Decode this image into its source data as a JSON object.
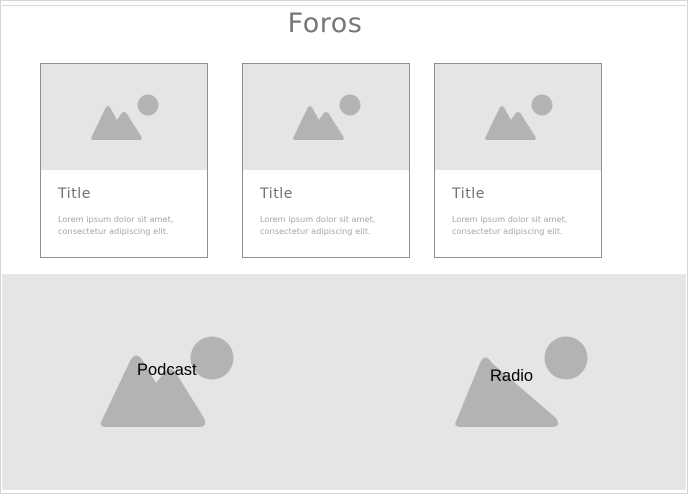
{
  "page": {
    "title": "Foros"
  },
  "cards": [
    {
      "title": "Title",
      "description": "Lorem ipsum dolor sit amet, consectetur adipiscing elit.",
      "image_icon": "image-placeholder-icon"
    },
    {
      "title": "Title",
      "description": "Lorem ipsum dolor sit amet, consectetur adipiscing elit.",
      "image_icon": "image-placeholder-icon"
    },
    {
      "title": "Title",
      "description": "Lorem ipsum dolor sit amet, consectetur adipiscing elit.",
      "image_icon": "image-placeholder-icon"
    }
  ],
  "media": [
    {
      "label": "Podcast",
      "image_icon": "image-placeholder-icon"
    },
    {
      "label": "Radio",
      "image_icon": "image-placeholder-icon"
    }
  ],
  "colors": {
    "placeholder_bg": "#e5e5e5",
    "placeholder_shape": "#b3b3b3",
    "title_text": "#777777",
    "card_border": "#8f8f8f"
  }
}
